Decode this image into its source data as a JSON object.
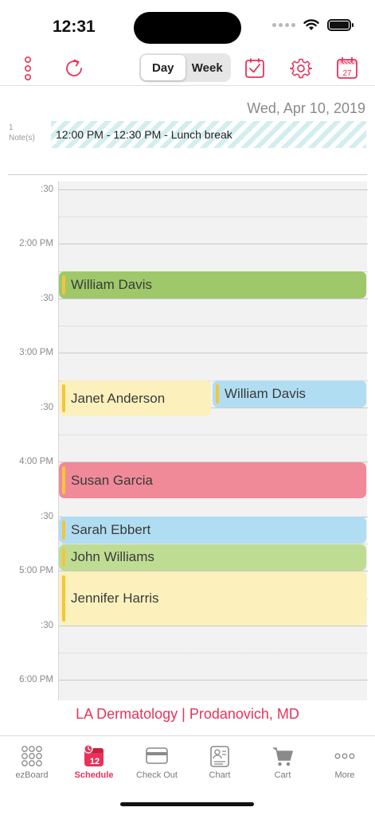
{
  "status_bar": {
    "time": "12:31"
  },
  "toolbar": {
    "segments": [
      {
        "label": "Day",
        "active": true
      },
      {
        "label": "Week",
        "active": false
      }
    ],
    "calendar_day": "27",
    "accent_color": "#e8325a"
  },
  "date_header": "Wed, Apr 10, 2019",
  "notes": {
    "count": "1",
    "count_label": "Note(s)",
    "text": "12:00 PM - 12:30 PM  - Lunch break"
  },
  "time_labels": [
    ":30",
    "2:00 PM",
    ":30",
    "3:00 PM",
    ":30",
    "4:00 PM",
    ":30",
    "5:00 PM",
    ":30",
    "6:00 PM"
  ],
  "appointments": [
    {
      "name": "William Davis",
      "color": "#9ec86a"
    },
    {
      "name": "Janet Anderson",
      "color": "#fcf1bd"
    },
    {
      "name": "William Davis",
      "color": "#b1ddf2"
    },
    {
      "name": "Susan Garcia",
      "color": "#f08a98"
    },
    {
      "name": "Sarah Ebbert",
      "color": "#b1ddf2"
    },
    {
      "name": "John Williams",
      "color": "#bfdc93"
    },
    {
      "name": "Jennifer Harris",
      "color": "#fcf1bd"
    }
  ],
  "footer": "LA Dermatology | Prodanovich, MD",
  "tabs": [
    {
      "label": "ezBoard",
      "icon": "grid-icon",
      "active": false
    },
    {
      "label": "Schedule",
      "icon": "calendar-icon",
      "active": true,
      "badge": "12"
    },
    {
      "label": "Check Out",
      "icon": "card-icon",
      "active": false
    },
    {
      "label": "Chart",
      "icon": "chart-icon",
      "active": false
    },
    {
      "label": "Cart",
      "icon": "cart-icon",
      "active": false
    },
    {
      "label": "More",
      "icon": "more-icon",
      "active": false
    }
  ]
}
